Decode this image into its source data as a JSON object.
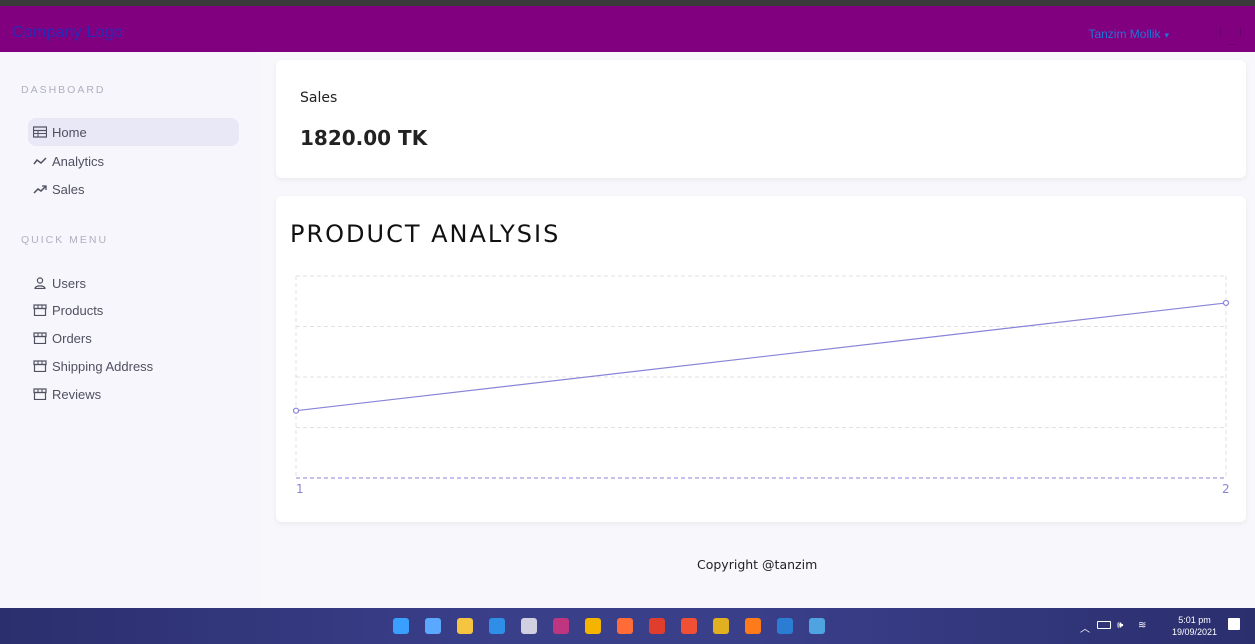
{
  "navbar": {
    "logo": "Company Logo",
    "user_name": "Tanzim Mollik",
    "caret": "▾"
  },
  "sidebar": {
    "dashboard_title": "DASHBOARD",
    "dashboard_items": [
      {
        "label": "Home",
        "icon": "table-icon",
        "active": true
      },
      {
        "label": "Analytics",
        "icon": "timeline-icon"
      },
      {
        "label": "Sales",
        "icon": "trending-up-icon"
      }
    ],
    "quick_title": "QUICK MENU",
    "quick_items": [
      {
        "label": "Users",
        "icon": "person-icon"
      },
      {
        "label": "Products",
        "icon": "storefront-icon"
      },
      {
        "label": "Orders",
        "icon": "storefront-icon"
      },
      {
        "label": "Shipping Address",
        "icon": "storefront-icon"
      },
      {
        "label": "Reviews",
        "icon": "storefront-icon"
      }
    ]
  },
  "sales_card": {
    "label": "Sales",
    "value": "1820.00 TK"
  },
  "analysis_card": {
    "title": "PRODUCT ANALYSIS"
  },
  "chart_data": {
    "type": "line",
    "x": [
      1,
      2
    ],
    "series": [
      {
        "values": [
          1,
          2.6
        ],
        "color": "#8884d8"
      }
    ],
    "ylim": [
      0,
      3
    ],
    "grid": true,
    "tick_labels_x": [
      "1",
      "2"
    ],
    "title": "",
    "xlabel": "",
    "ylabel": ""
  },
  "footer": {
    "text": "Copyright @tanzim"
  },
  "taskbar": {
    "time": "5:01 pm",
    "date": "19/09/2021",
    "icons": [
      "windows-start-icon",
      "widgets-icon",
      "file-explorer-icon",
      "vscode-icon",
      "app-icon",
      "phpstorm-icon",
      "chrome-icon",
      "postman-icon",
      "obs-icon",
      "git-icon",
      "app-icon",
      "firefox-icon",
      "word-icon",
      "photos-icon"
    ],
    "icon_colors": [
      "#3aa0ff",
      "#5aa8ff",
      "#f5c542",
      "#2f8ee5",
      "#d0d0e0",
      "#c0357f",
      "#f4b400",
      "#ff6c37",
      "#e03e2d",
      "#f05033",
      "#e0b020",
      "#ff7a1a",
      "#2b7cd3",
      "#4fa3e0"
    ]
  },
  "colors": {
    "navbar": "#800080",
    "accent": "#8884d8",
    "logo": "#2a2ab8",
    "user": "#1e74d6"
  }
}
